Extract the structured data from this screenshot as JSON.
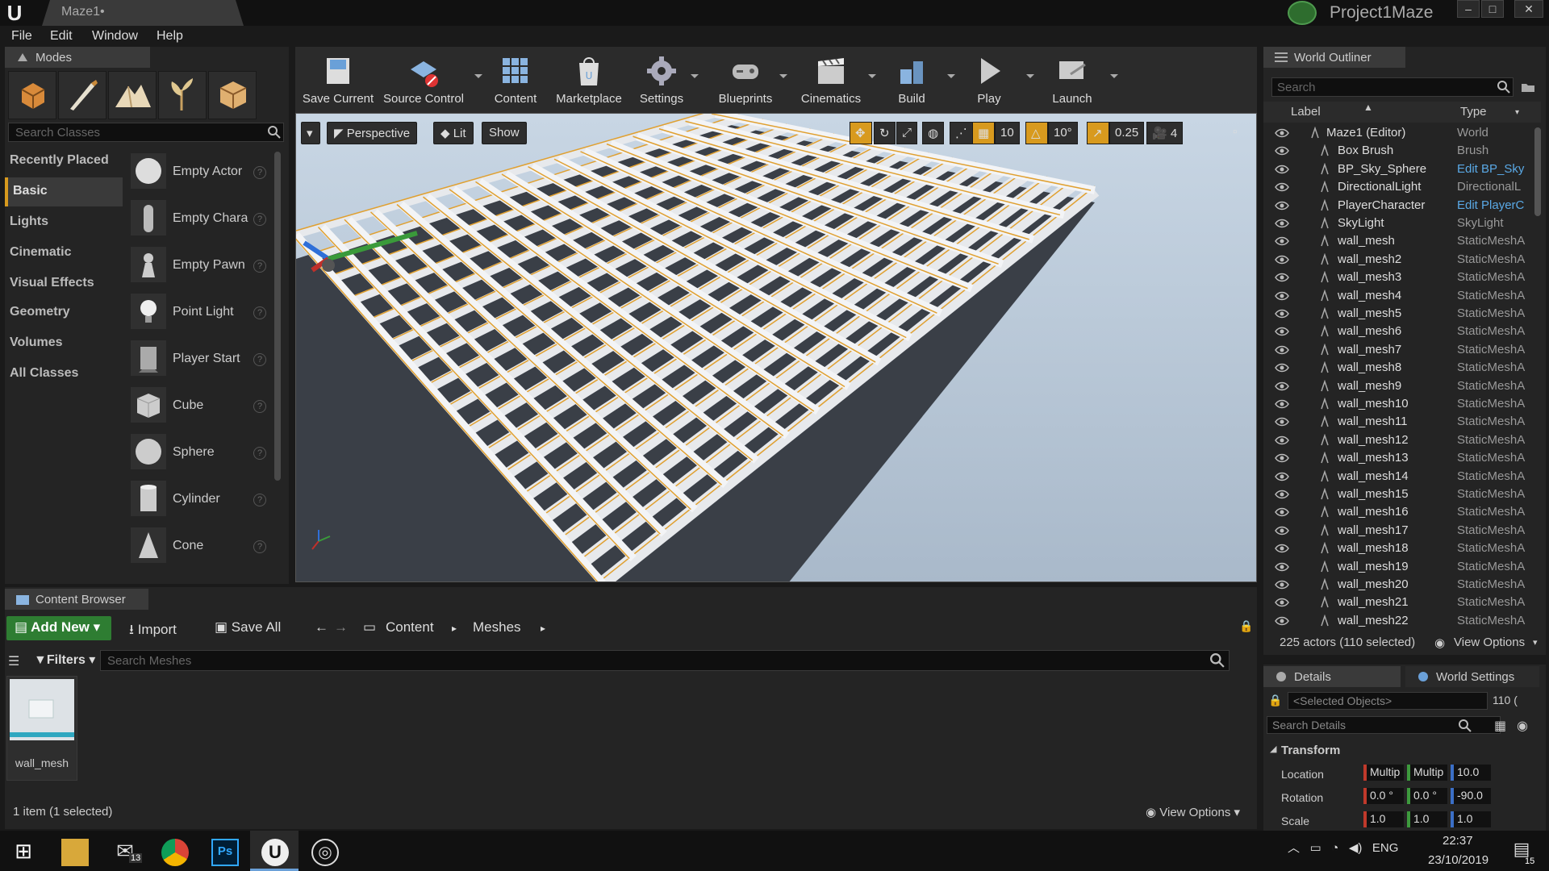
{
  "window": {
    "doc_tab": "Maze1•",
    "project_name": "Project1Maze",
    "min": "–",
    "max": "□",
    "close": "✕"
  },
  "menu": [
    "File",
    "Edit",
    "Window",
    "Help"
  ],
  "modes": {
    "tab_label": "Modes",
    "search_placeholder": "Search Classes",
    "categories": [
      "Recently Placed",
      "Basic",
      "Lights",
      "Cinematic",
      "Visual Effects",
      "Geometry",
      "Volumes",
      "All Classes"
    ],
    "active_category": "Basic",
    "items": [
      "Empty Actor",
      "Empty Chara",
      "Empty Pawn",
      "Point Light",
      "Player Start",
      "Cube",
      "Sphere",
      "Cylinder",
      "Cone"
    ]
  },
  "toolbar": {
    "buttons": [
      "Save Current",
      "Source Control",
      "Content",
      "Marketplace",
      "Settings",
      "Blueprints",
      "Cinematics",
      "Build",
      "Play",
      "Launch"
    ]
  },
  "viewport": {
    "perspective": "Perspective",
    "lit": "Lit",
    "show": "Show",
    "grid_snap": "10",
    "rotation_snap": "10°",
    "scale_snap": "0.25",
    "camera_speed": "4"
  },
  "outliner": {
    "tab_label": "World Outliner",
    "search_placeholder": "Search",
    "col_label": "Label",
    "col_type": "Type",
    "rows": [
      {
        "label": "Maze1 (Editor)",
        "type": "World",
        "link": false
      },
      {
        "label": "Box Brush",
        "type": "Brush",
        "link": false
      },
      {
        "label": "BP_Sky_Sphere",
        "type": "Edit BP_Sky",
        "link": true
      },
      {
        "label": "DirectionalLight",
        "type": "DirectionalL",
        "link": false
      },
      {
        "label": "PlayerCharacter",
        "type": "Edit PlayerC",
        "link": true
      },
      {
        "label": "SkyLight",
        "type": "SkyLight",
        "link": false
      },
      {
        "label": "wall_mesh",
        "type": "StaticMeshA",
        "link": false
      },
      {
        "label": "wall_mesh2",
        "type": "StaticMeshA",
        "link": false
      },
      {
        "label": "wall_mesh3",
        "type": "StaticMeshA",
        "link": false
      },
      {
        "label": "wall_mesh4",
        "type": "StaticMeshA",
        "link": false
      },
      {
        "label": "wall_mesh5",
        "type": "StaticMeshA",
        "link": false
      },
      {
        "label": "wall_mesh6",
        "type": "StaticMeshA",
        "link": false
      },
      {
        "label": "wall_mesh7",
        "type": "StaticMeshA",
        "link": false
      },
      {
        "label": "wall_mesh8",
        "type": "StaticMeshA",
        "link": false
      },
      {
        "label": "wall_mesh9",
        "type": "StaticMeshA",
        "link": false
      },
      {
        "label": "wall_mesh10",
        "type": "StaticMeshA",
        "link": false
      },
      {
        "label": "wall_mesh11",
        "type": "StaticMeshA",
        "link": false
      },
      {
        "label": "wall_mesh12",
        "type": "StaticMeshA",
        "link": false
      },
      {
        "label": "wall_mesh13",
        "type": "StaticMeshA",
        "link": false
      },
      {
        "label": "wall_mesh14",
        "type": "StaticMeshA",
        "link": false
      },
      {
        "label": "wall_mesh15",
        "type": "StaticMeshA",
        "link": false
      },
      {
        "label": "wall_mesh16",
        "type": "StaticMeshA",
        "link": false
      },
      {
        "label": "wall_mesh17",
        "type": "StaticMeshA",
        "link": false
      },
      {
        "label": "wall_mesh18",
        "type": "StaticMeshA",
        "link": false
      },
      {
        "label": "wall_mesh19",
        "type": "StaticMeshA",
        "link": false
      },
      {
        "label": "wall_mesh20",
        "type": "StaticMeshA",
        "link": false
      },
      {
        "label": "wall_mesh21",
        "type": "StaticMeshA",
        "link": false
      },
      {
        "label": "wall_mesh22",
        "type": "StaticMeshA",
        "link": false
      }
    ],
    "footer_count": "225 actors (110 selected)",
    "view_options": "View Options"
  },
  "details": {
    "tab_label": "Details",
    "world_settings_tab": "World Settings",
    "selected_placeholder": "<Selected Objects>",
    "selected_count": "110 (",
    "search_placeholder": "Search Details",
    "section": "Transform",
    "location_label": "Location",
    "rotation_label": "Rotation",
    "scale_label": "Scale",
    "location": [
      "Multip",
      "Multip",
      "10.0"
    ],
    "rotation": [
      "0.0 °",
      "0.0 °",
      "-90.0"
    ],
    "scale": [
      "1.0",
      "1.0",
      "1.0"
    ]
  },
  "content_browser": {
    "tab_label": "Content Browser",
    "add_new": "Add New",
    "import": "Import",
    "save_all": "Save All",
    "path": [
      "Content",
      "Meshes"
    ],
    "filters": "Filters",
    "search_placeholder": "Search Meshes",
    "asset_name": "wall_mesh",
    "status": "1 item (1 selected)",
    "view_options": "View Options"
  },
  "taskbar": {
    "mail_badge": "13",
    "lang": "ENG",
    "time": "22:37",
    "date": "23/10/2019",
    "notif_badge": "15"
  },
  "colors": {
    "accent_orange": "#d89a1e",
    "add_new_green": "#2e7d32",
    "link_blue": "#5aa9e6"
  }
}
